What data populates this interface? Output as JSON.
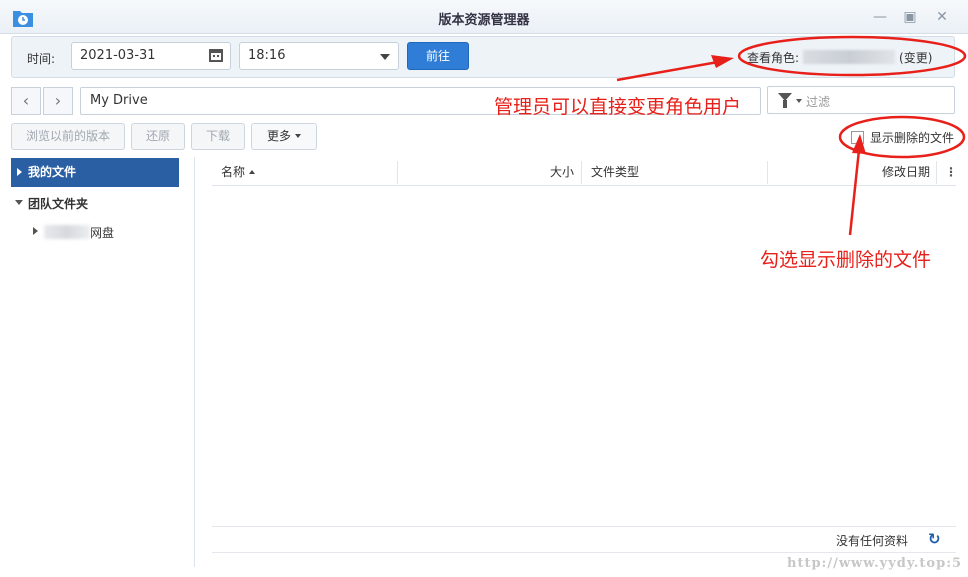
{
  "window": {
    "title": "版本资源管理器",
    "controls": {
      "minimize": "—",
      "maximize": "▣",
      "close": "✕"
    },
    "icon": "folder-clock-icon"
  },
  "timebar": {
    "time_label": "时间:",
    "date_value": "2021-03-31",
    "time_value": "18:16",
    "go_label": "前往",
    "role_label": "查看角色:",
    "change_label": "(变更)"
  },
  "navigation": {
    "back": "‹",
    "forward": "›",
    "path": "My Drive",
    "filter_placeholder": "过滤"
  },
  "toolbar": {
    "browse_label": "浏览以前的版本",
    "restore_label": "还原",
    "download_label": "下载",
    "more_label": "更多",
    "show_deleted_label": "显示删除的文件"
  },
  "sidebar": {
    "my_files": "我的文件",
    "team_folders": "团队文件夹",
    "child_suffix": "网盘"
  },
  "columns": {
    "name": "名称",
    "size": "大小",
    "type": "文件类型",
    "modified": "修改日期",
    "menu": "⋮"
  },
  "footer": {
    "status": "没有任何资料",
    "refresh": "↻"
  },
  "annotations": {
    "role_note": "管理员可以直接变更角色用户",
    "deleted_note": "勾选显示删除的文件",
    "color": "#e8201a"
  },
  "colors": {
    "accent": "#2f7dd6",
    "selected": "#2b5fa3"
  },
  "watermark": "http://www.yydy.top:5"
}
